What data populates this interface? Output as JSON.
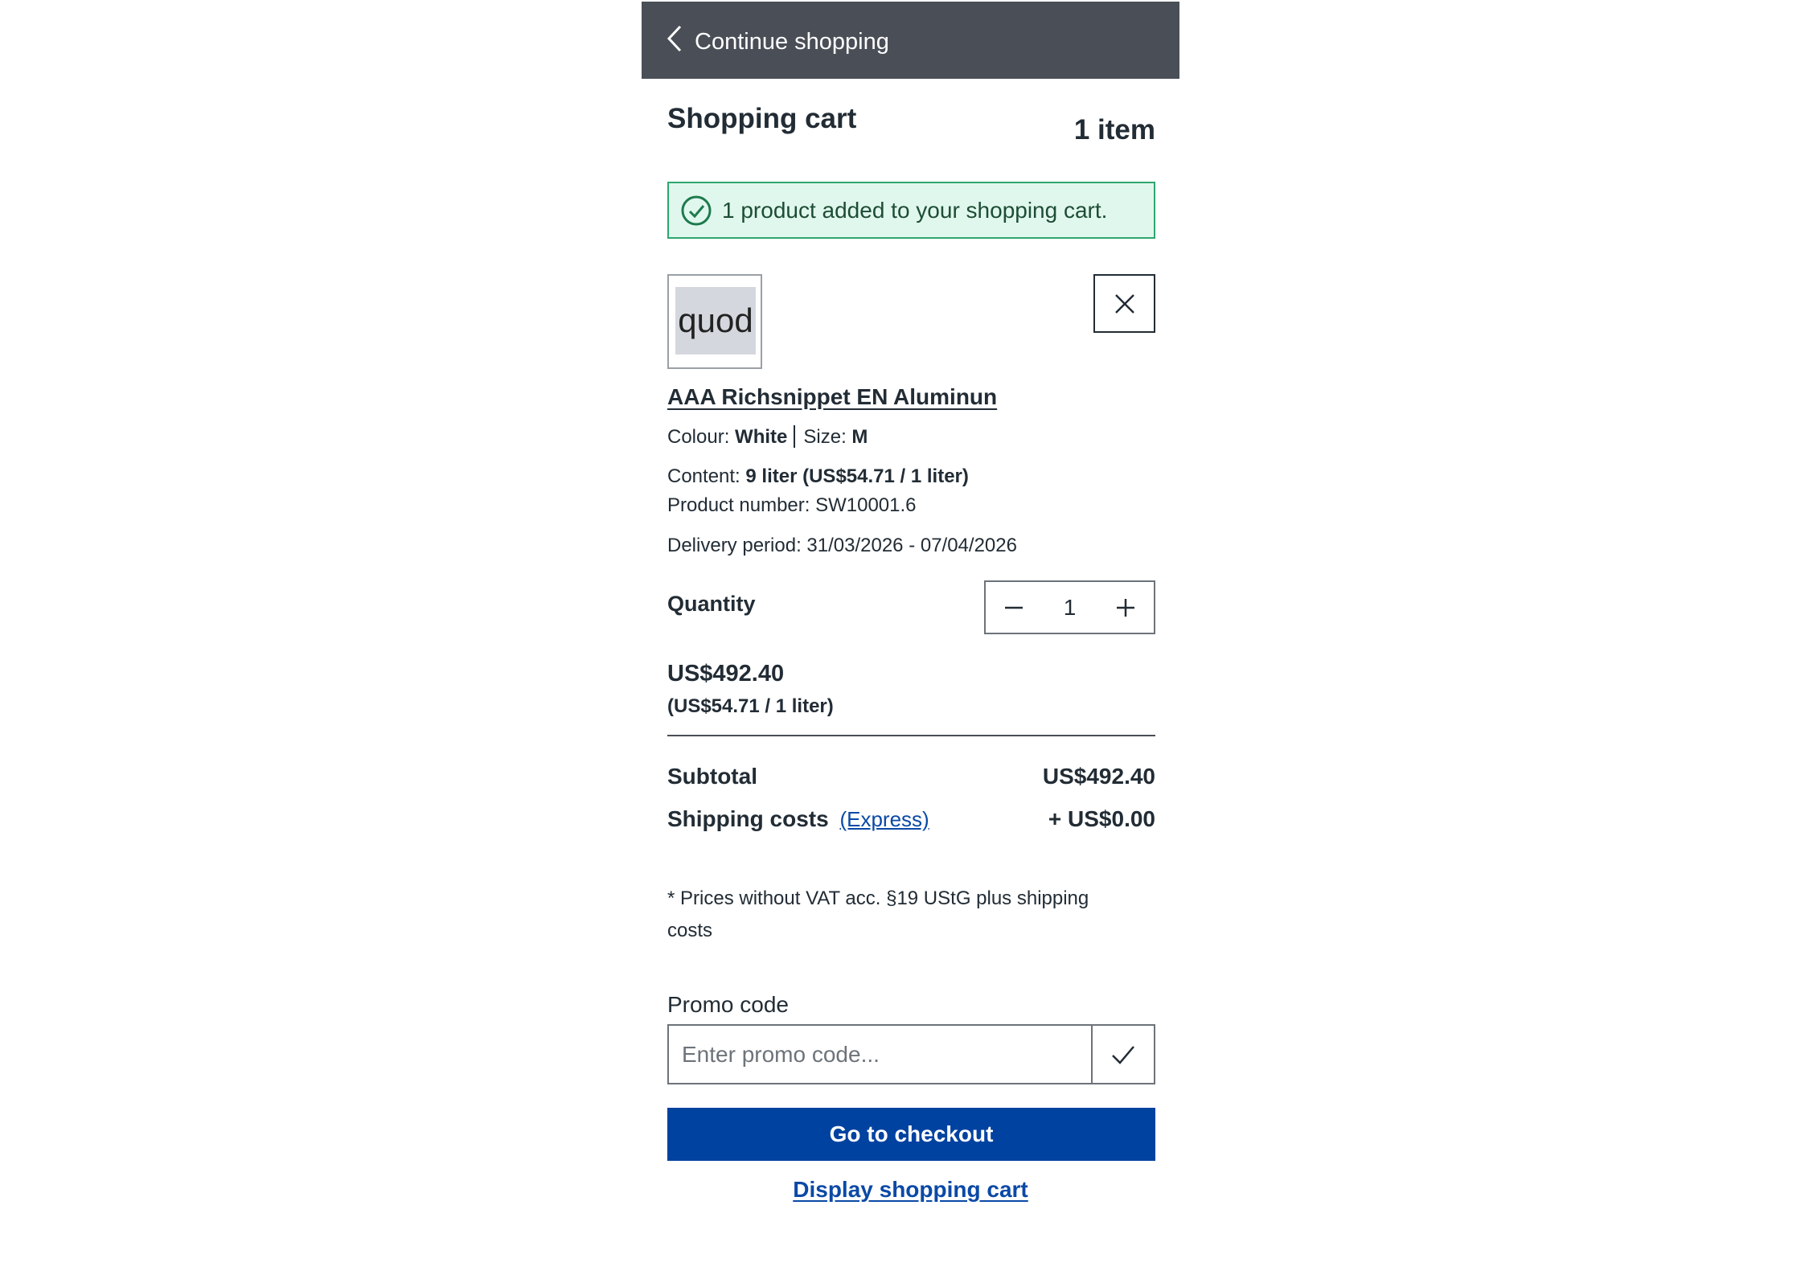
{
  "header": {
    "back_label": "Continue shopping"
  },
  "cart": {
    "title": "Shopping cart",
    "item_count": "1 item",
    "alert": "1 product added to your shopping cart."
  },
  "line_item": {
    "thumbnail_text": "quod",
    "name": "AAA Richsnippet EN Aluminun",
    "colour_label": "Colour:",
    "colour_value": "White",
    "size_label": "Size:",
    "size_value": "M",
    "content_label": "Content:",
    "content_value": "9 liter (US$54.71 / 1 liter)",
    "product_number": "Product number: SW10001.6",
    "delivery": "Delivery period: 31/03/2026 - 07/04/2026",
    "quantity_label": "Quantity",
    "quantity_value": "1",
    "price": "US$492.40",
    "reference_price": "(US$54.71 / 1 liter)"
  },
  "summary": {
    "subtotal_label": "Subtotal",
    "subtotal_value": "US$492.40",
    "shipping_label": "Shipping costs",
    "shipping_method": "(Express)",
    "shipping_value": "+ US$0.00",
    "vat_note": "* Prices without VAT acc. §19 UStG plus shipping costs"
  },
  "promo": {
    "label": "Promo code",
    "placeholder": "Enter promo code..."
  },
  "actions": {
    "checkout": "Go to checkout",
    "display_cart": "Display shopping cart"
  },
  "colors": {
    "header_bg": "#4a4e57",
    "primary": "#0042a0",
    "success_bg": "#e0f7ee",
    "success_border": "#2da76e",
    "link": "#0b49a6"
  }
}
